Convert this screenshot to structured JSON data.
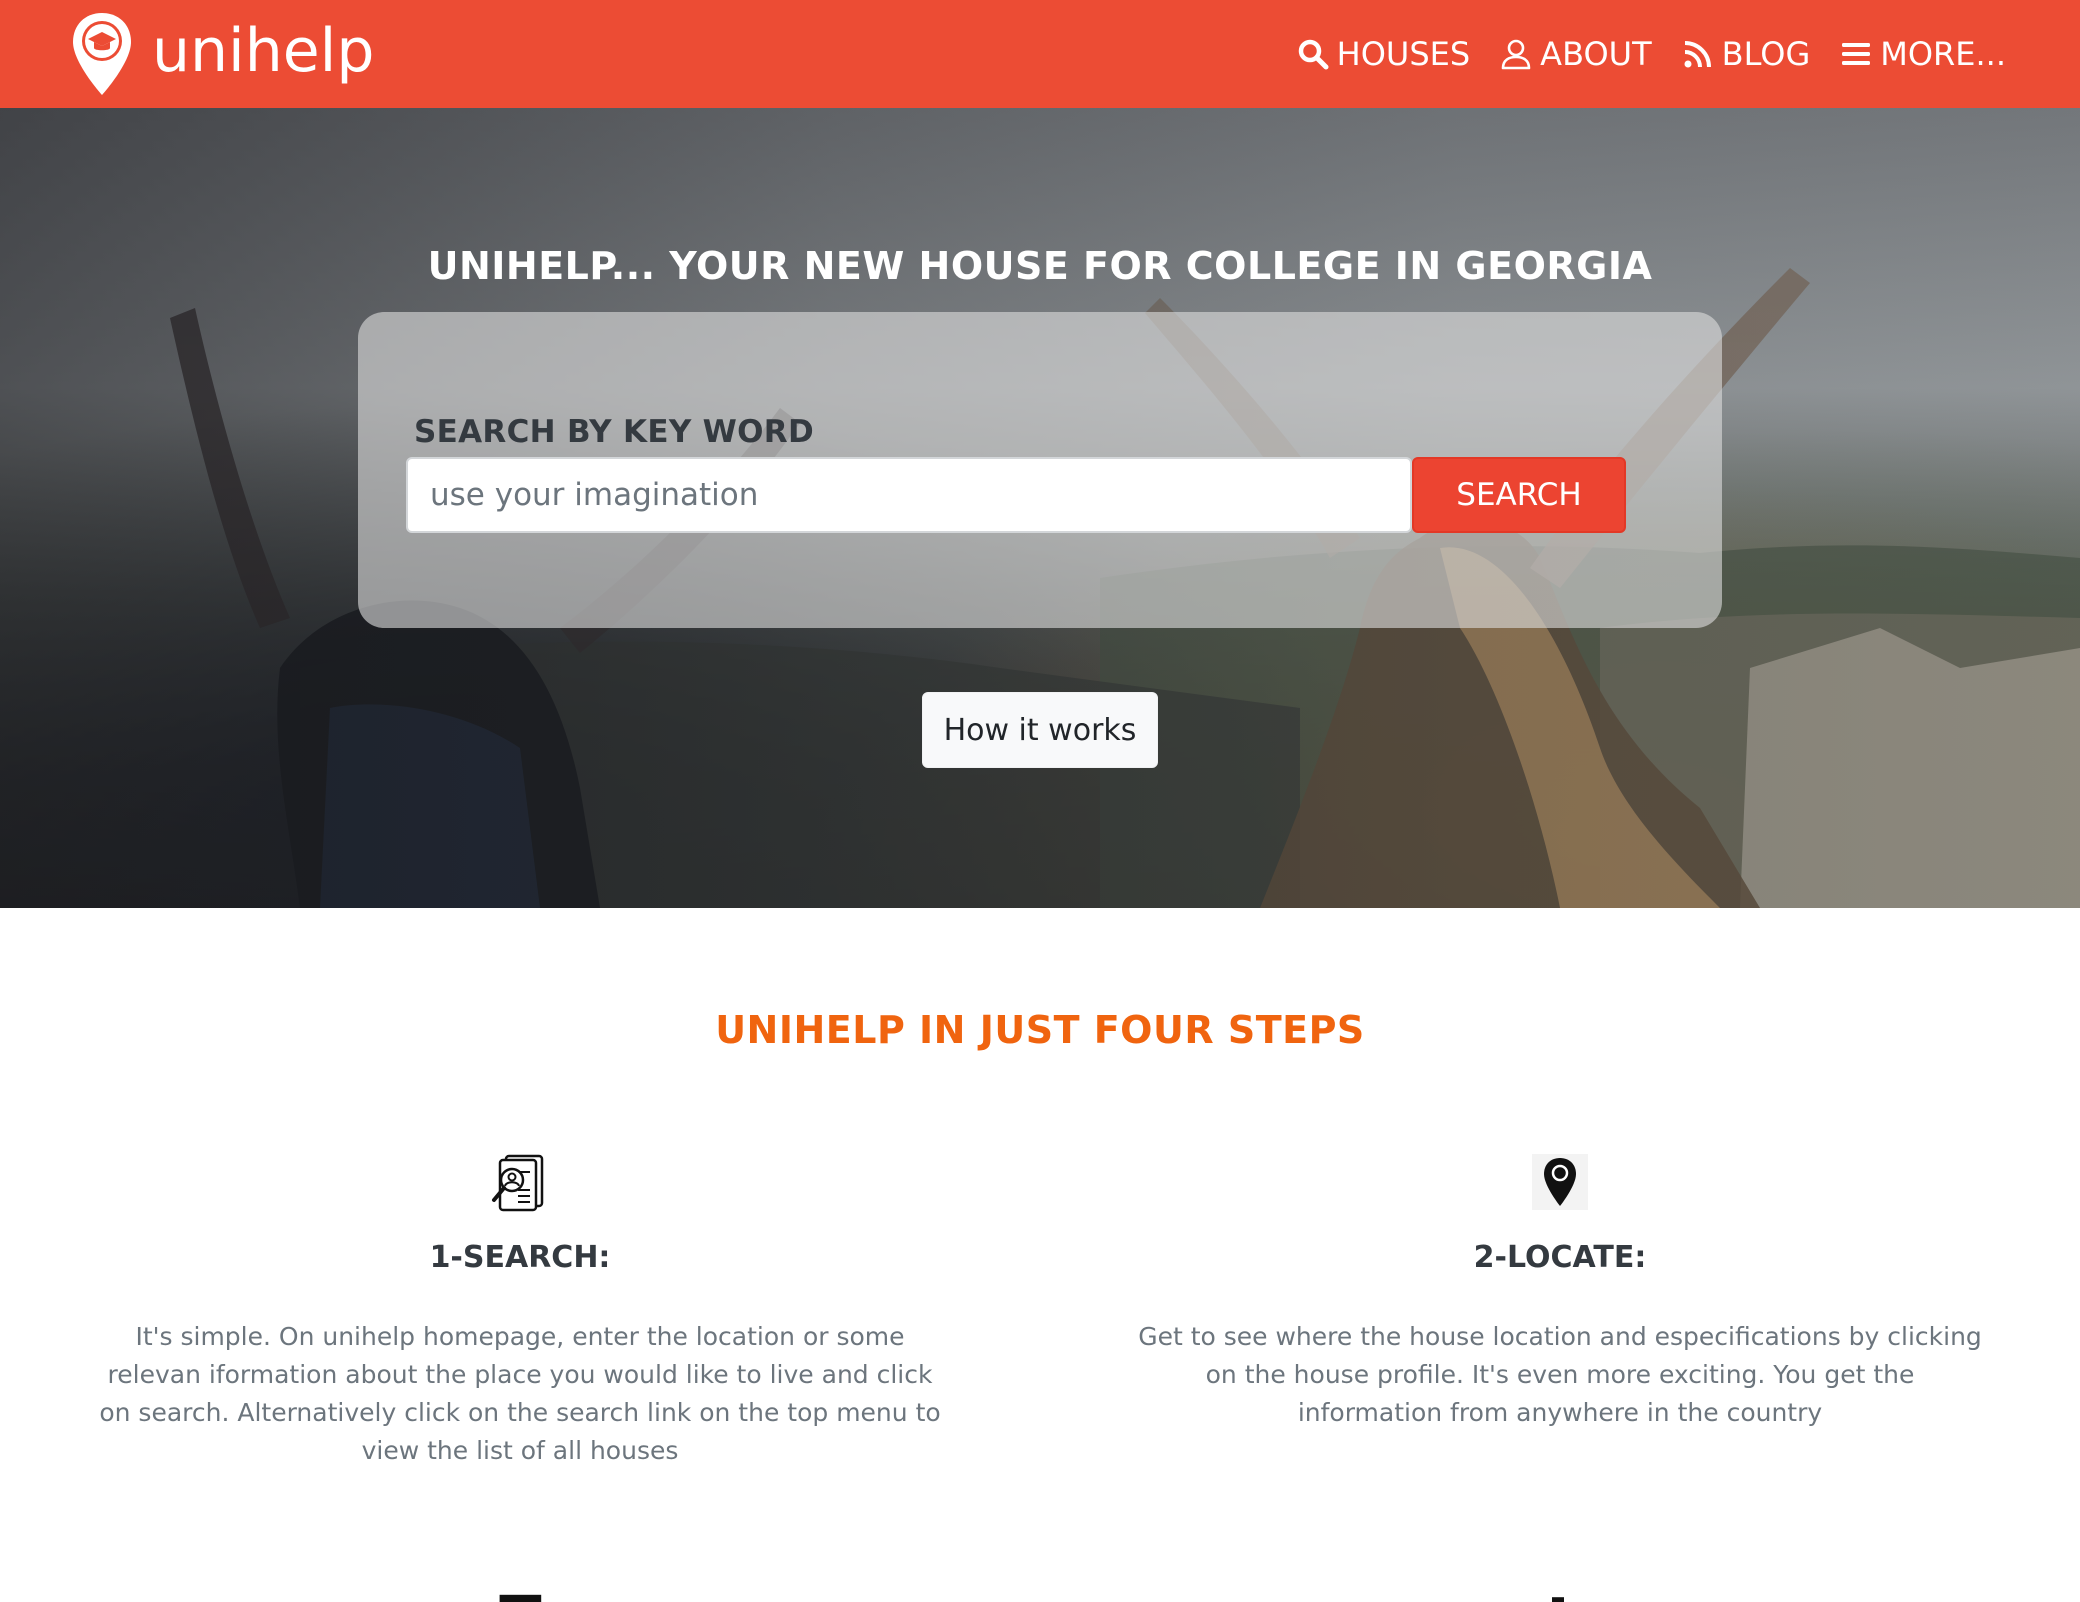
{
  "brand": {
    "name": "unihelp",
    "colors": {
      "primary": "#ec4c34",
      "accent": "#f0640f"
    },
    "logo_icon": "map-pin-graduation-cap-icon"
  },
  "nav": {
    "items": [
      {
        "label": "HOUSES",
        "icon": "search-icon"
      },
      {
        "label": "ABOUT",
        "icon": "user-icon"
      },
      {
        "label": "BLOG",
        "icon": "rss-icon"
      },
      {
        "label": "MORE...",
        "icon": "menu-icon"
      }
    ]
  },
  "hero": {
    "title": "UNIHELP... YOUR NEW HOUSE FOR COLLEGE IN GEORGIA",
    "search_label": "SEARCH BY KEY WORD",
    "search_placeholder": "use your imagination",
    "search_value": "",
    "search_button": "SEARCH",
    "how_button": "How it works"
  },
  "steps": {
    "title": "UNIHELP IN JUST FOUR STEPS",
    "items": [
      {
        "heading": "1-SEARCH:",
        "icon": "document-search-icon",
        "text": "It's simple. On unihelp homepage, enter the location or some relevan iformation about the place you would like to live and click on search. Alternatively click on the search link on the top menu to view the list of all houses"
      },
      {
        "heading": "2-LOCATE:",
        "icon": "map-pin-icon",
        "text": "Get to see where the house location and especifications by clicking on the house profile. It's even more exciting. You get the information from anywhere in the country"
      }
    ]
  }
}
